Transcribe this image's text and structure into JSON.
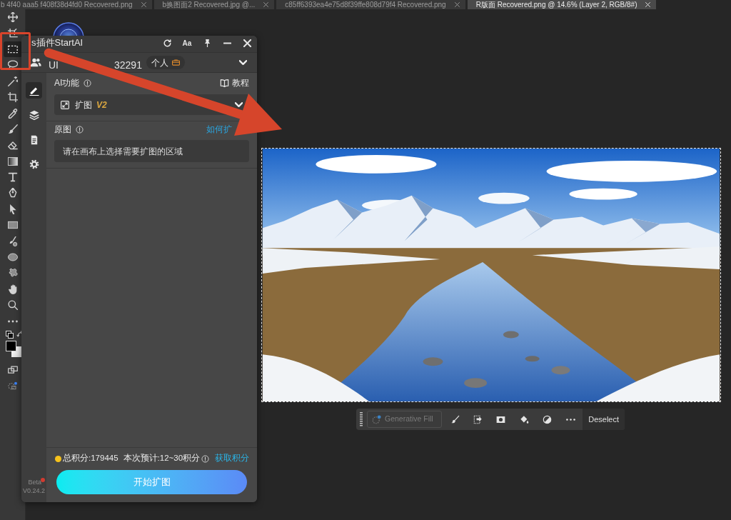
{
  "document_tabs": [
    {
      "label": "b 4f40 aaa5 f408f38d4fd0 Recovered.png",
      "selected": false
    },
    {
      "label": "b换图面2 Recovered.jpg @...",
      "selected": false
    },
    {
      "label": "c85ff6393ea4e75d8f39ffe808d79f4 Recovered.png",
      "selected": false
    },
    {
      "label": "R版面 Recovered.png @ 14.6% (Layer 2, RGB/8#)",
      "selected": true
    }
  ],
  "toolbar": {
    "tools": [
      {
        "kind": "move",
        "selected": false
      },
      {
        "kind": "artboard",
        "selected": false
      },
      {
        "kind": "marquee",
        "selected": true
      },
      {
        "kind": "lasso",
        "selected": false
      },
      {
        "kind": "wand",
        "selected": false
      },
      {
        "kind": "crop",
        "selected": false
      },
      {
        "kind": "eyedropper",
        "selected": false
      },
      {
        "kind": "brush",
        "selected": false
      },
      {
        "kind": "eraser",
        "selected": false
      },
      {
        "kind": "gradient",
        "selected": false
      },
      {
        "kind": "type",
        "selected": false
      },
      {
        "kind": "pen",
        "selected": false
      },
      {
        "kind": "path_select",
        "selected": false
      },
      {
        "kind": "rectangle",
        "selected": false
      },
      {
        "kind": "paint",
        "selected": false
      },
      {
        "kind": "ellipse",
        "selected": false
      },
      {
        "kind": "blob",
        "selected": false
      },
      {
        "kind": "hand",
        "selected": false
      },
      {
        "kind": "zoom",
        "selected": false
      },
      {
        "kind": "more",
        "selected": false
      }
    ]
  },
  "plugin_panel": {
    "title": "s插件StartAI",
    "font_button": "Aa",
    "user": {
      "uid_start": "UI",
      "uid_end": "32291",
      "plan_badge": "个人"
    },
    "sidebar_tabs": [
      {
        "kind": "edit",
        "selected": true
      },
      {
        "kind": "layers",
        "selected": false
      },
      {
        "kind": "save",
        "selected": false
      },
      {
        "kind": "settings",
        "selected": false
      }
    ],
    "ai_function": {
      "label": "AI功能",
      "tutorial_link": "教程",
      "dropdown": {
        "value": "扩图",
        "version_badge": "V2"
      }
    },
    "source_image": {
      "label": "原图",
      "help_link": "如何扩",
      "message": "请在画布上选择需要扩图的区域"
    },
    "credits": {
      "total": "总积分:179445",
      "estimate": "本次预计:12~30积分",
      "get_link": "获取积分"
    },
    "start_button": "开始扩图",
    "beta_label": "Beta",
    "version": "V0.24.2"
  },
  "contextual_taskbar": {
    "generative_fill": {
      "label": "Generative Fill",
      "disabled": true
    },
    "deselect": "Deselect"
  }
}
